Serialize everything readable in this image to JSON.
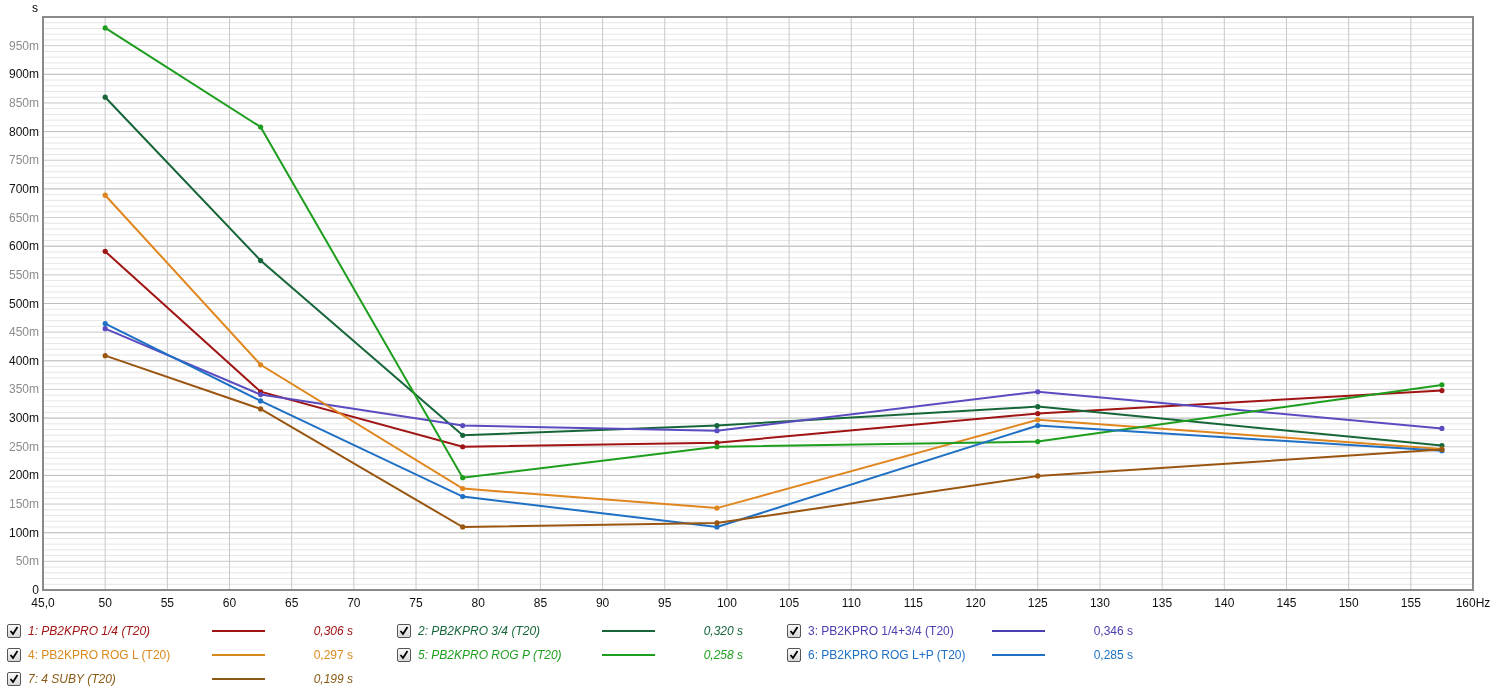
{
  "chart": {
    "chart_data": {
      "type": "line",
      "grid": true,
      "ylabel": "s",
      "xlim": [
        45,
        160
      ],
      "ylim": [
        0,
        1000
      ],
      "x": [
        50,
        62.5,
        78.75,
        99.2,
        125,
        157.5
      ],
      "xticks": [
        {
          "value": 45,
          "label": "45,0"
        },
        50,
        55,
        60,
        65,
        70,
        75,
        80,
        85,
        90,
        95,
        100,
        105,
        110,
        115,
        120,
        125,
        130,
        135,
        140,
        145,
        150,
        155,
        {
          "value": 160,
          "label": "160Hz"
        }
      ],
      "yticks": [
        {
          "value": 0,
          "label": "0"
        },
        {
          "value": 50,
          "label": "50m"
        },
        {
          "value": 100,
          "label": "100m"
        },
        {
          "value": 150,
          "label": "150m"
        },
        {
          "value": 200,
          "label": "200m"
        },
        {
          "value": 250,
          "label": "250m"
        },
        {
          "value": 300,
          "label": "300m"
        },
        {
          "value": 350,
          "label": "350m"
        },
        {
          "value": 400,
          "label": "400m"
        },
        {
          "value": 450,
          "label": "450m"
        },
        {
          "value": 500,
          "label": "500m"
        },
        {
          "value": 550,
          "label": "550m"
        },
        {
          "value": 600,
          "label": "600m"
        },
        {
          "value": 650,
          "label": "650m"
        },
        {
          "value": 700,
          "label": "700m"
        },
        {
          "value": 750,
          "label": "750m"
        },
        {
          "value": 800,
          "label": "800m"
        },
        {
          "value": 850,
          "label": "850m"
        },
        {
          "value": 900,
          "label": "900m"
        },
        {
          "value": 950,
          "label": "950m"
        }
      ],
      "series": [
        {
          "color": "#a01414",
          "values": [
            591,
            346,
            250,
            257,
            308,
            348
          ]
        },
        {
          "color": "#17663a",
          "values": [
            860,
            575,
            270,
            287,
            320,
            252
          ]
        },
        {
          "color": "#5a4cc0",
          "values": [
            456,
            341,
            287,
            278,
            346,
            282
          ]
        },
        {
          "color": "#e0861e",
          "values": [
            689,
            393,
            177,
            143,
            297,
            246
          ]
        },
        {
          "color": "#1e9e1e",
          "values": [
            981,
            808,
            196,
            250,
            259,
            358
          ]
        },
        {
          "color": "#1f70c4",
          "values": [
            465,
            330,
            163,
            110,
            287,
            243
          ]
        },
        {
          "color": "#9a5510",
          "values": [
            409,
            316,
            110,
            117,
            199,
            245
          ]
        }
      ]
    }
  },
  "legend": [
    {
      "label": "1: PB2KPRO 1/4 (T20)",
      "value": "0,306 s",
      "color": "#a01414",
      "checked": true,
      "italic": true
    },
    {
      "label": "2: PB2KPRO 3/4 (T20)",
      "value": "0,320 s",
      "color": "#17663a",
      "checked": true,
      "italic": true
    },
    {
      "label": "3: PB2KPRO 1/4+3/4 (T20)",
      "value": "0,346 s",
      "color": "#4a3fb0",
      "checked": true,
      "italic": false
    },
    {
      "label": "4: PB2KPRO ROG L (T20)",
      "value": "0,297 s",
      "color": "#d98a1e",
      "checked": true,
      "italic": false
    },
    {
      "label": "5: PB2KPRO ROG P (T20)",
      "value": "0,258 s",
      "color": "#1e9e1e",
      "checked": true,
      "italic": true
    },
    {
      "label": "6: PB2KPRO ROG L+P (T20)",
      "value": "0,285 s",
      "color": "#1f70c4",
      "checked": true,
      "italic": false
    },
    {
      "label": "7: 4 SUBY (T20)",
      "value": "0,199 s",
      "color": "#8a5a14",
      "checked": true,
      "italic": true
    }
  ]
}
